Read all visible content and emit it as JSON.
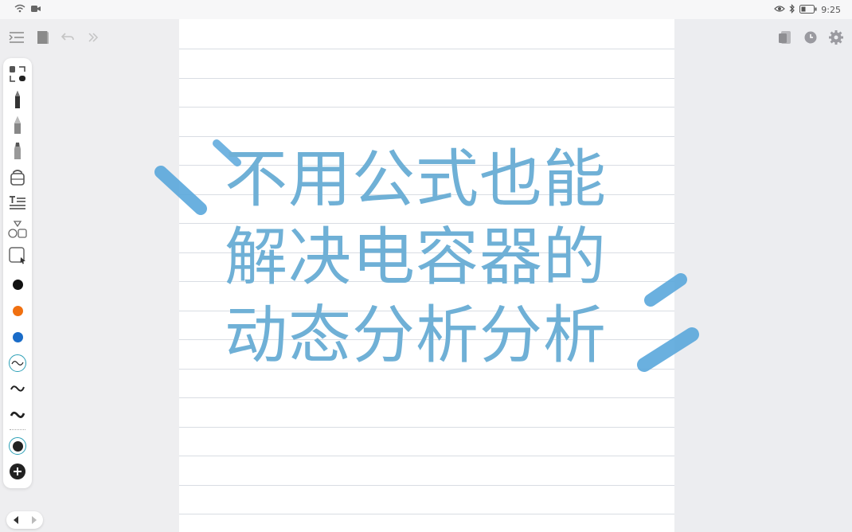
{
  "status_bar": {
    "time": "9:25",
    "left_icons": [
      "wifi-icon",
      "camera-icon"
    ],
    "right_icons": [
      "eye-icon",
      "bluetooth-icon",
      "battery-icon"
    ]
  },
  "top_bar": {
    "left_icons": [
      "menu-icon",
      "notebook-icon",
      "undo-icon",
      "forward-icon"
    ],
    "right_icons": [
      "page-icon",
      "clock-icon",
      "settings-icon"
    ]
  },
  "toolbar": {
    "tools": [
      "lasso-icon",
      "pen-icon",
      "pencil-icon",
      "highlighter-icon",
      "eraser-icon",
      "text-icon",
      "shapes-icon",
      "image-icon"
    ],
    "colors": [
      "#111111",
      "#f07010",
      "#1a6cc8"
    ],
    "stroke_widths": [
      "thin",
      "medium",
      "thick"
    ],
    "current_color": "#222222"
  },
  "note": {
    "title_lines": [
      "不用公式也能",
      "解决电容器的",
      "动态分析分析"
    ],
    "title_color": "#6fb0d6",
    "accent_color": "#5aa8dc"
  }
}
